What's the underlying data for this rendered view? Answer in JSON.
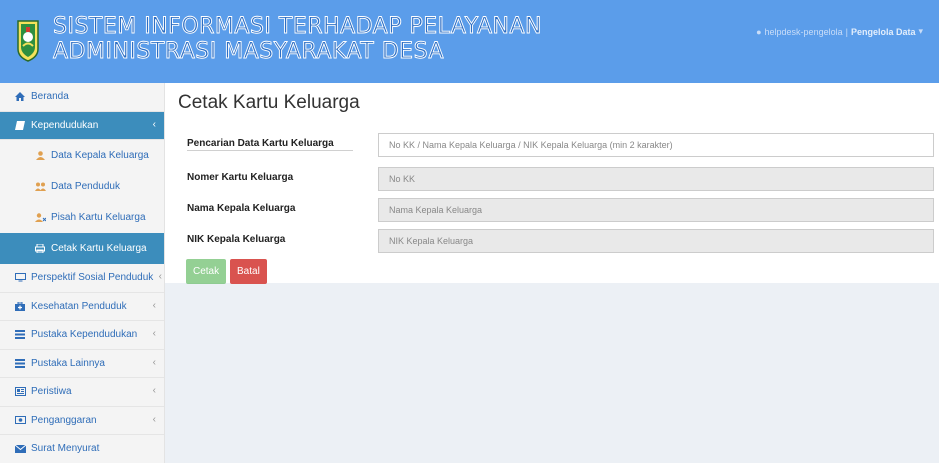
{
  "header": {
    "title_line1": "SISTEM INFORMASI TERHADAP PELAYANAN",
    "title_line2": "ADMINISTRASI MASYARAKAT DESA",
    "user_name": "helpdesk-pengelola",
    "separator": "|",
    "user_role": "Pengelola Data",
    "caret": "▾"
  },
  "sidebar": {
    "items": [
      {
        "label": "Beranda",
        "icon": "home-icon"
      },
      {
        "label": "Kependudukan",
        "icon": "book-icon",
        "chevron": "‹"
      },
      {
        "label": "Data Kepala Keluarga",
        "icon": "user-icon"
      },
      {
        "label": "Data Penduduk",
        "icon": "users-icon"
      },
      {
        "label": "Pisah Kartu Keluarga",
        "icon": "user-times-icon"
      },
      {
        "label": "Cetak Kartu Keluarga",
        "icon": "print-icon"
      },
      {
        "label": "Perspektif Sosial Penduduk",
        "icon": "desktop-icon",
        "chevron": "‹"
      },
      {
        "label": "Kesehatan Penduduk",
        "icon": "medkit-icon",
        "chevron": "‹"
      },
      {
        "label": "Pustaka Kependudukan",
        "icon": "list-icon",
        "chevron": "‹"
      },
      {
        "label": "Pustaka Lainnya",
        "icon": "list-icon",
        "chevron": "‹"
      },
      {
        "label": "Peristiwa",
        "icon": "newspaper-icon",
        "chevron": "‹"
      },
      {
        "label": "Penganggaran",
        "icon": "money-icon",
        "chevron": "‹"
      },
      {
        "label": "Surat Menyurat",
        "icon": "envelope-icon"
      }
    ]
  },
  "main": {
    "page_title": "Cetak Kartu Keluarga",
    "fields": [
      {
        "label": "Pencarian Data Kartu Keluarga",
        "placeholder": "No KK / Nama Kepala Keluarga / NIK Kepala Keluarga (min 2 karakter)"
      },
      {
        "label": "Nomer Kartu Keluarga",
        "placeholder": "No KK"
      },
      {
        "label": "Nama Kepala Keluarga",
        "placeholder": "Nama Kepala Keluarga"
      },
      {
        "label": "NIK Kepala Keluarga",
        "placeholder": "NIK Kepala Keluarga"
      }
    ],
    "buttons": {
      "print": "Cetak",
      "cancel": "Batal"
    }
  },
  "colors": {
    "header": "#5b9dea",
    "active": "#3c8dbc",
    "success": "#5cb85c",
    "danger": "#d9534f"
  }
}
